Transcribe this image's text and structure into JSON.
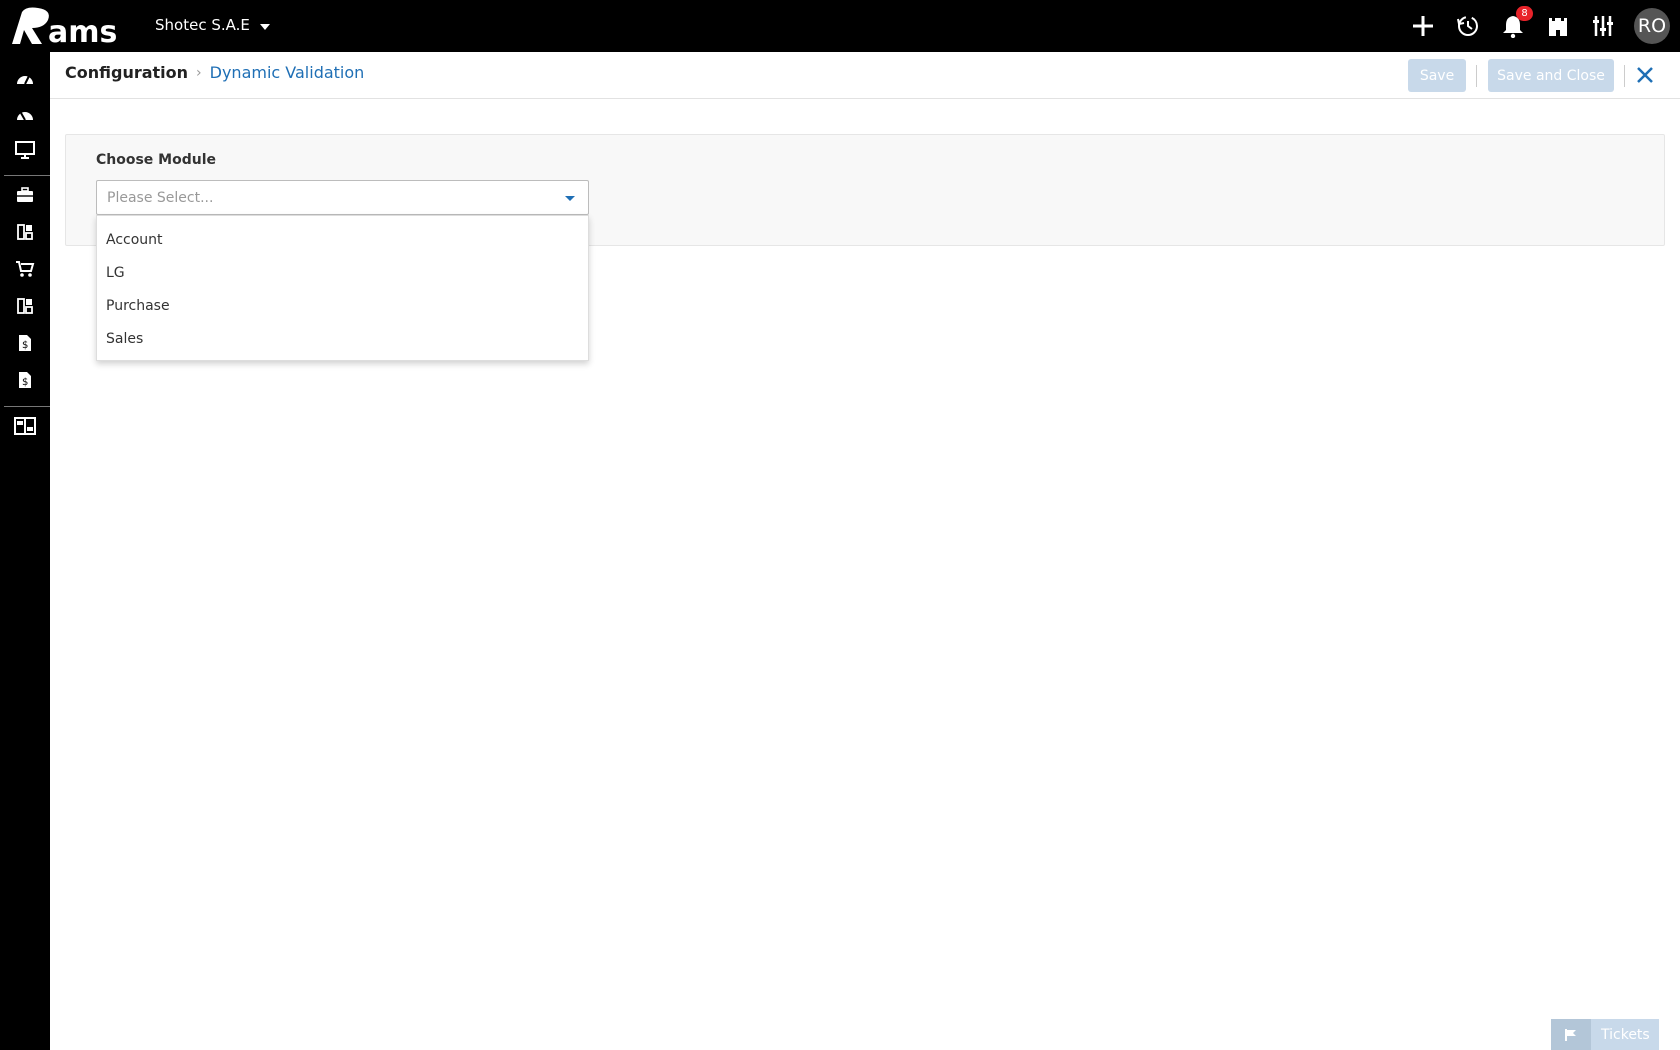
{
  "topbar": {
    "logo_text": "Rams",
    "company": "Shotec S.A.E",
    "notification_count": "8",
    "avatar_initials": "RO",
    "icons": [
      "plus-icon",
      "history-icon",
      "bell-icon",
      "castle-icon",
      "sliders-icon"
    ]
  },
  "sidebar": {
    "items": [
      "dashboard-icon",
      "dashboard-alt-icon",
      "monitor-icon",
      "briefcase-icon",
      "grid-icon",
      "cart-icon",
      "grid-alt-icon",
      "invoice-icon",
      "invoice-alt-icon",
      "report-icon"
    ]
  },
  "header": {
    "breadcrumb_root": "Configuration",
    "breadcrumb_current": "Dynamic Validation",
    "save_label": "Save",
    "save_close_label": "Save and Close"
  },
  "form": {
    "label": "Choose Module",
    "placeholder": "Please Select...",
    "options": [
      "Account",
      "LG",
      "Purchase",
      "Sales"
    ]
  },
  "tickets": {
    "label": "Tickets"
  },
  "colors": {
    "accent": "#1f6fb5",
    "button_disabled": "#c8d9ea",
    "topbar": "#000000",
    "badge": "#e8232a"
  }
}
